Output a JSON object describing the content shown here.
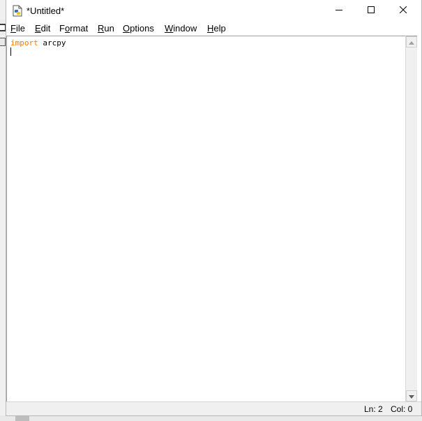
{
  "window": {
    "title": "*Untitled*",
    "app_icon": "python-idle-file-icon",
    "controls": {
      "minimize_icon": "minimize-icon",
      "maximize_icon": "maximize-icon",
      "close_icon": "close-icon"
    }
  },
  "menu": {
    "items": [
      {
        "mnemonic": "F",
        "rest": "ile"
      },
      {
        "mnemonic": "E",
        "rest": "dit"
      },
      {
        "prefix": "F",
        "mnemonic": "o",
        "rest": "rmat"
      },
      {
        "mnemonic": "R",
        "rest": "un"
      },
      {
        "mnemonic": "O",
        "rest": "ptions"
      },
      {
        "mnemonic": "W",
        "rest": "indow"
      },
      {
        "mnemonic": "H",
        "rest": "elp"
      }
    ]
  },
  "editor": {
    "lines": [
      {
        "keyword": "import",
        "text": " arcpy"
      },
      {
        "keyword": "",
        "text": ""
      }
    ],
    "keyword_color": "#ff7700"
  },
  "status": {
    "ln": "Ln: 2",
    "col": "Col: 0"
  }
}
